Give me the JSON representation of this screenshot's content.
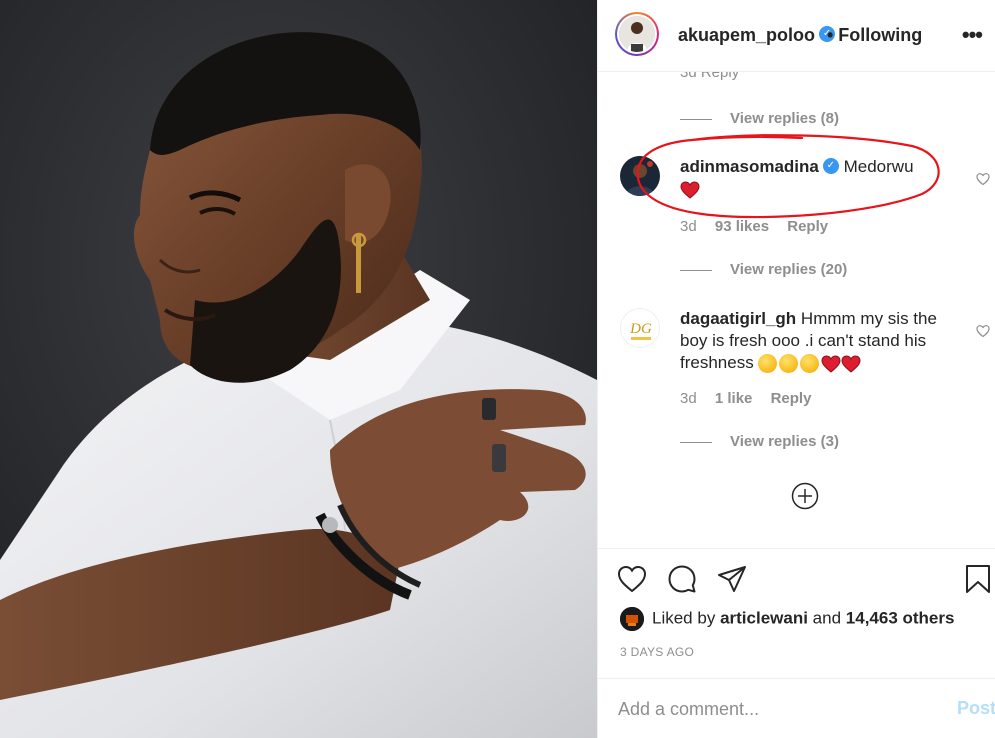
{
  "post_author": {
    "username": "akuapem_poloo",
    "verified_icon": "verified-check-icon",
    "follow_state": "• Following",
    "more_label": "•••"
  },
  "comments_panel": {
    "cut_off_meta": "3d   Reply",
    "replies_top": "View replies (8)",
    "comments": [
      {
        "username": "adinmasomadina",
        "verified": true,
        "text": "Medorwu",
        "emojis": [
          "red-heart"
        ],
        "age": "3d",
        "likes": "93 likes",
        "reply": "Reply",
        "view_replies": "View replies (20)",
        "highlight_color": "#e8141b"
      },
      {
        "username": "dagaatigirl_gh",
        "verified": false,
        "text": "Hmmm my sis the boy is fresh ooo .i can't stand his freshness",
        "emojis": [
          "weary-face",
          "weary-face",
          "weary-face",
          "red-heart",
          "red-heart"
        ],
        "age": "3d",
        "likes": "1 like",
        "reply": "Reply",
        "view_replies": "View replies (3)",
        "avatar_text": "DG"
      }
    ],
    "load_more_icon": "plus-circle-icon"
  },
  "actions": {
    "icons": [
      "heart-icon",
      "comment-icon",
      "share-icon",
      "bookmark-icon"
    ],
    "liked_prefix": "Liked by",
    "liked_user": "articlewani",
    "liked_and": "and",
    "liked_count": "14,463 others",
    "timestamp": "3 DAYS AGO"
  },
  "add_comment": {
    "placeholder": "Add a comment...",
    "post_label": "Post"
  },
  "colors": {
    "verified": "#3897f0",
    "secondary_text": "#8e8e8e",
    "post_disabled": "#b2dffc",
    "heart": "#ed4956"
  }
}
